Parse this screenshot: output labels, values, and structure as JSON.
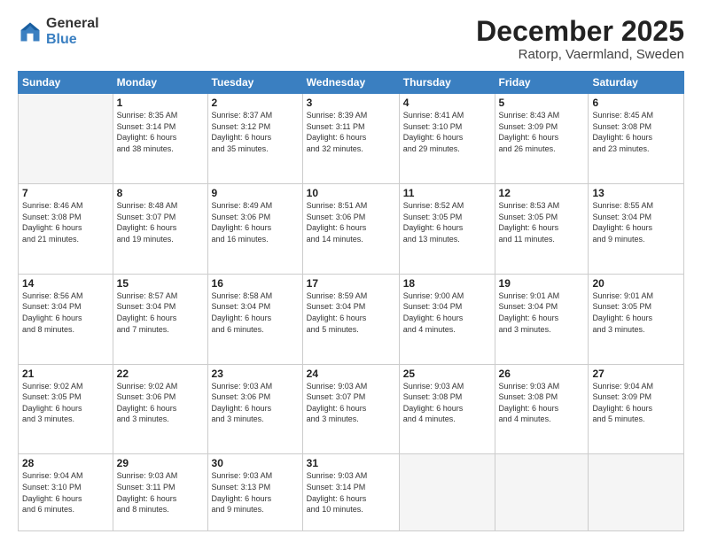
{
  "logo": {
    "general": "General",
    "blue": "Blue"
  },
  "header": {
    "month": "December 2025",
    "location": "Ratorp, Vaermland, Sweden"
  },
  "days": [
    "Sunday",
    "Monday",
    "Tuesday",
    "Wednesday",
    "Thursday",
    "Friday",
    "Saturday"
  ],
  "weeks": [
    [
      {
        "day": "",
        "content": ""
      },
      {
        "day": "1",
        "content": "Sunrise: 8:35 AM\nSunset: 3:14 PM\nDaylight: 6 hours\nand 38 minutes."
      },
      {
        "day": "2",
        "content": "Sunrise: 8:37 AM\nSunset: 3:12 PM\nDaylight: 6 hours\nand 35 minutes."
      },
      {
        "day": "3",
        "content": "Sunrise: 8:39 AM\nSunset: 3:11 PM\nDaylight: 6 hours\nand 32 minutes."
      },
      {
        "day": "4",
        "content": "Sunrise: 8:41 AM\nSunset: 3:10 PM\nDaylight: 6 hours\nand 29 minutes."
      },
      {
        "day": "5",
        "content": "Sunrise: 8:43 AM\nSunset: 3:09 PM\nDaylight: 6 hours\nand 26 minutes."
      },
      {
        "day": "6",
        "content": "Sunrise: 8:45 AM\nSunset: 3:08 PM\nDaylight: 6 hours\nand 23 minutes."
      }
    ],
    [
      {
        "day": "7",
        "content": "Sunrise: 8:46 AM\nSunset: 3:08 PM\nDaylight: 6 hours\nand 21 minutes."
      },
      {
        "day": "8",
        "content": "Sunrise: 8:48 AM\nSunset: 3:07 PM\nDaylight: 6 hours\nand 19 minutes."
      },
      {
        "day": "9",
        "content": "Sunrise: 8:49 AM\nSunset: 3:06 PM\nDaylight: 6 hours\nand 16 minutes."
      },
      {
        "day": "10",
        "content": "Sunrise: 8:51 AM\nSunset: 3:06 PM\nDaylight: 6 hours\nand 14 minutes."
      },
      {
        "day": "11",
        "content": "Sunrise: 8:52 AM\nSunset: 3:05 PM\nDaylight: 6 hours\nand 13 minutes."
      },
      {
        "day": "12",
        "content": "Sunrise: 8:53 AM\nSunset: 3:05 PM\nDaylight: 6 hours\nand 11 minutes."
      },
      {
        "day": "13",
        "content": "Sunrise: 8:55 AM\nSunset: 3:04 PM\nDaylight: 6 hours\nand 9 minutes."
      }
    ],
    [
      {
        "day": "14",
        "content": "Sunrise: 8:56 AM\nSunset: 3:04 PM\nDaylight: 6 hours\nand 8 minutes."
      },
      {
        "day": "15",
        "content": "Sunrise: 8:57 AM\nSunset: 3:04 PM\nDaylight: 6 hours\nand 7 minutes."
      },
      {
        "day": "16",
        "content": "Sunrise: 8:58 AM\nSunset: 3:04 PM\nDaylight: 6 hours\nand 6 minutes."
      },
      {
        "day": "17",
        "content": "Sunrise: 8:59 AM\nSunset: 3:04 PM\nDaylight: 6 hours\nand 5 minutes."
      },
      {
        "day": "18",
        "content": "Sunrise: 9:00 AM\nSunset: 3:04 PM\nDaylight: 6 hours\nand 4 minutes."
      },
      {
        "day": "19",
        "content": "Sunrise: 9:01 AM\nSunset: 3:04 PM\nDaylight: 6 hours\nand 3 minutes."
      },
      {
        "day": "20",
        "content": "Sunrise: 9:01 AM\nSunset: 3:05 PM\nDaylight: 6 hours\nand 3 minutes."
      }
    ],
    [
      {
        "day": "21",
        "content": "Sunrise: 9:02 AM\nSunset: 3:05 PM\nDaylight: 6 hours\nand 3 minutes."
      },
      {
        "day": "22",
        "content": "Sunrise: 9:02 AM\nSunset: 3:06 PM\nDaylight: 6 hours\nand 3 minutes."
      },
      {
        "day": "23",
        "content": "Sunrise: 9:03 AM\nSunset: 3:06 PM\nDaylight: 6 hours\nand 3 minutes."
      },
      {
        "day": "24",
        "content": "Sunrise: 9:03 AM\nSunset: 3:07 PM\nDaylight: 6 hours\nand 3 minutes."
      },
      {
        "day": "25",
        "content": "Sunrise: 9:03 AM\nSunset: 3:08 PM\nDaylight: 6 hours\nand 4 minutes."
      },
      {
        "day": "26",
        "content": "Sunrise: 9:03 AM\nSunset: 3:08 PM\nDaylight: 6 hours\nand 4 minutes."
      },
      {
        "day": "27",
        "content": "Sunrise: 9:04 AM\nSunset: 3:09 PM\nDaylight: 6 hours\nand 5 minutes."
      }
    ],
    [
      {
        "day": "28",
        "content": "Sunrise: 9:04 AM\nSunset: 3:10 PM\nDaylight: 6 hours\nand 6 minutes."
      },
      {
        "day": "29",
        "content": "Sunrise: 9:03 AM\nSunset: 3:11 PM\nDaylight: 6 hours\nand 8 minutes."
      },
      {
        "day": "30",
        "content": "Sunrise: 9:03 AM\nSunset: 3:13 PM\nDaylight: 6 hours\nand 9 minutes."
      },
      {
        "day": "31",
        "content": "Sunrise: 9:03 AM\nSunset: 3:14 PM\nDaylight: 6 hours\nand 10 minutes."
      },
      {
        "day": "",
        "content": ""
      },
      {
        "day": "",
        "content": ""
      },
      {
        "day": "",
        "content": ""
      }
    ]
  ]
}
